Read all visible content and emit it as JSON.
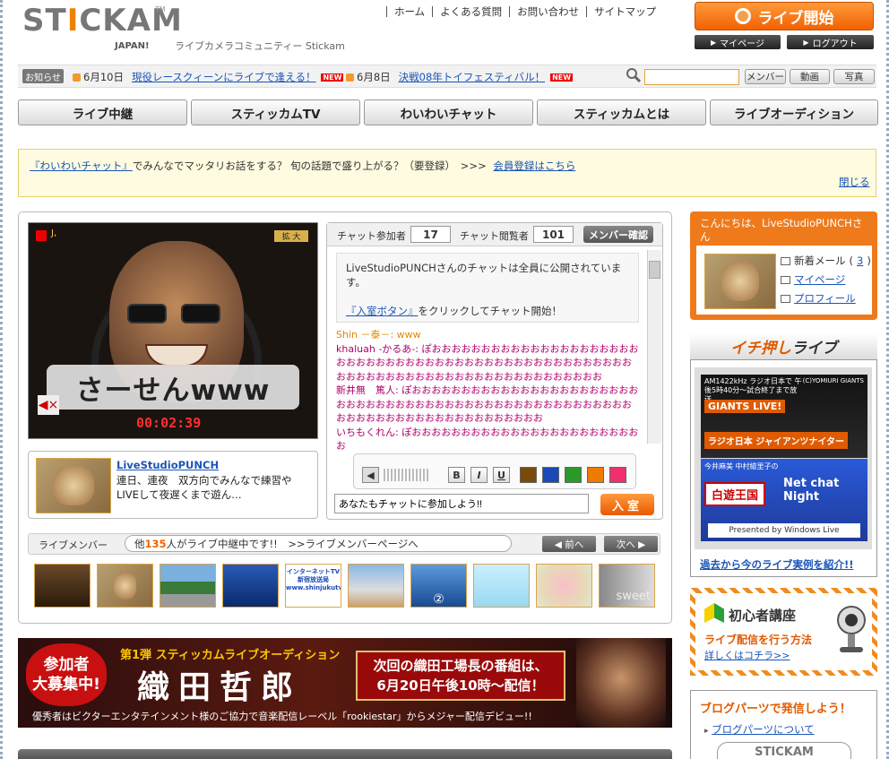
{
  "header": {
    "logo_text": "STICKAM",
    "logo_sub": "JAPAN!",
    "logo_tm": "TM",
    "tagline": "ライブカメラコミュニティー Stickam",
    "topnav": [
      "ホーム",
      "よくある質問",
      "お問い合わせ",
      "サイトマップ"
    ],
    "live_button": "ライブ開始",
    "mypage_button": "マイページ",
    "logout_button": "ログアウト"
  },
  "newsbar": {
    "label": "お知らせ",
    "items": [
      {
        "date": "6月10日",
        "text": "現役レースクィーンにライブで逢える！",
        "badge": "NEW"
      },
      {
        "date": "6月8日",
        "text": "決戦08年トイフェスティバル！",
        "badge": "NEW"
      }
    ],
    "search_placeholder": "",
    "buttons": [
      "メンバー",
      "動画",
      "写真"
    ]
  },
  "mainnav": [
    "ライブ中継",
    "スティッカムTV",
    "わいわいチャット",
    "スティッカムとは",
    "ライブオーディション"
  ],
  "notice": {
    "link": "『わいわいチャット』",
    "text": "でみんなでマッタリお話をする？ 旬の話題で盛り上がる？（要登録）　>>>",
    "register_link": "会員登録はこちら",
    "close": "閉じる"
  },
  "video": {
    "flag_text": "J,",
    "expand": "拡 大",
    "caption": "さーせんwww",
    "timer": "00:02:39"
  },
  "streamer": {
    "name": "LiveStudioPUNCH",
    "desc": "連日、連夜　双方向でみんなで練習やLIVEして夜遅くまで遊ん…"
  },
  "chat": {
    "participants_label": "チャット参加者",
    "participants": "17",
    "viewers_label": "チャット閲覧者",
    "viewers": "101",
    "member_check": "メンバー確認",
    "info_line1": "LiveStudioPUNCHさんのチャットは全員に公開されています。",
    "info_link": "『入室ボタン』",
    "info_line2": "をクリックしてチャット開始！",
    "messages": [
      {
        "user": "Shin",
        "text": " －泰－: www",
        "color": "#e08a00"
      },
      {
        "user": "khaluah",
        "text": " -かるあ-: ぽおおおおおおおおおおおおおおおおおおおおおおおおおおおおおおおおおおおおおおおおおおおおおおおおおおおおおおおおおおおおおおおおおおおおおおおおおおおおおお",
        "color": "#b0006a"
      },
      {
        "user": "新井無",
        "text": "　篤人: ぽおおおおおおおおおおおおおおおおおおおおおおおおおおおおおおおおおおおおおおおおおおおおおおおおおおおおおおおおおおおおおおおおおおおおおおおおおお",
        "color": "#b0006a"
      },
      {
        "user": "いちもくれん",
        "text": ": ぽおおおおおおおおおおおおおおおおおおおおおおおお",
        "color": "#b0006a"
      }
    ],
    "format_buttons": [
      "B",
      "I",
      "U"
    ],
    "swatches": [
      "#7a4a0a",
      "#1a4ab8",
      "#2a9a2a",
      "#f07a00",
      "#f0306a"
    ],
    "input_value": "あなたもチャットに参加しよう!!",
    "enter_button": "入室"
  },
  "live_members": {
    "label": "ライブメンバー",
    "count_prefix": "他",
    "count": "135",
    "count_suffix": "人がライブ中継中です!!　>>ライブメンバーページへ",
    "prev": "◀ 前へ",
    "next": "次へ ▶",
    "thumb_texts": [
      "",
      "",
      "",
      "",
      "インターネットTV 新宿放送局 www.shinjukutv.com",
      "",
      "②",
      "",
      "",
      "sweet"
    ]
  },
  "banner": {
    "bubble1": "参加者",
    "bubble2": "大募集中!",
    "sub": "第1弾 スティッカムライブオーディション",
    "name": "織田哲郎",
    "next1": "次回の織田工場長の番組は、",
    "next2": "6月20日午後10時～配信！",
    "foot": "優秀者はビクターエンタテインメント様のご協力で音楽配信レーベル「rookiestar」からメジャー配信デビュー!!"
  },
  "sidebar": {
    "welcome": "こんにちは、LiveStudioPUNCHさん",
    "mail": "新着メール",
    "mail_count": "3",
    "mypage": "マイページ",
    "profile": "プロフィール",
    "pickup_title_a": "イチ押し",
    "pickup_title_b": "ライブ",
    "giants_top": "AM1422kHz ラジオ日本で 午後5時40分～試合終了まで放送",
    "giants_mark": "(C)YOMIURI GIANTS",
    "giants_live": "GIANTS LIVE!",
    "giants_show": "ラジオ日本 ジャイアンツナイター",
    "netchat_top": "今井麻美 中村繪里子の",
    "netchat_h": "白遊王国",
    "netchat_t": "Net chat Night",
    "netchat_ms": "Presented by Windows Live",
    "pickup_link": "過去から今のライブ実例を紹介!!",
    "beginner_title": "初心者講座",
    "beginner_sub": "ライブ配信を行う方法",
    "beginner_link": "詳しくはコチラ>>",
    "blog_title": "ブログパーツで発信しよう！",
    "blog_link": "ブログパーツについて",
    "blog_logo": "STICKAM"
  }
}
